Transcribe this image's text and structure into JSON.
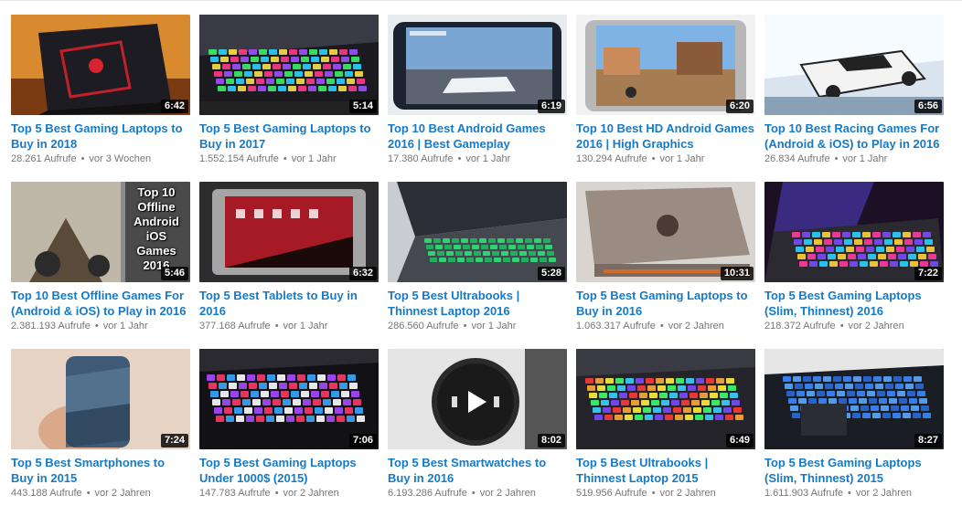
{
  "colors": {
    "title_link": "#167ac6",
    "meta_text": "#767676",
    "duration_bg": "#000000"
  },
  "videos": [
    {
      "title": "Top 5 Best Gaming Laptops to Buy in 2018",
      "views": "28.261 Aufrufe",
      "age": "vor 3 Wochen",
      "duration": "6:42",
      "thumb": "laptop-red"
    },
    {
      "title": "Top 5 Best Gaming Laptops to Buy in 2017",
      "views": "1.552.154 Aufrufe",
      "age": "vor 1 Jahr",
      "duration": "5:14",
      "thumb": "keyboard-rgb"
    },
    {
      "title": "Top 10 Best Android Games 2016 | Best Gameplay",
      "views": "17.380 Aufrufe",
      "age": "vor 1 Jahr",
      "duration": "6:19",
      "thumb": "phone-racing"
    },
    {
      "title": "Top 10 Best HD Android Games 2016 | High Graphics",
      "views": "130.294 Aufrufe",
      "age": "vor 1 Jahr",
      "duration": "6:20",
      "thumb": "phone-town"
    },
    {
      "title": "Top 10 Best Racing Games For (Android & iOS) to Play in 2016",
      "views": "26.834 Aufrufe",
      "age": "vor 1 Jahr",
      "duration": "6:56",
      "thumb": "snow-car"
    },
    {
      "title": "Top 10 Best Offline Games For (Android & iOS) to Play in 2016",
      "views": "2.381.193 Aufrufe",
      "age": "vor 1 Jahr",
      "duration": "5:46",
      "thumb": "offline-games",
      "overlay_text": [
        "Top 10",
        "Offline",
        "Android",
        "iOS",
        "Games",
        "2016"
      ]
    },
    {
      "title": "Top 5 Best Tablets to Buy in 2016",
      "views": "377.168 Aufrufe",
      "age": "vor 1 Jahr",
      "duration": "6:32",
      "thumb": "tablet"
    },
    {
      "title": "Top 5 Best Ultrabooks | Thinnest Laptop 2016",
      "views": "286.560 Aufrufe",
      "age": "vor 1 Jahr",
      "duration": "5:28",
      "thumb": "ultrabook-green"
    },
    {
      "title": "Top 5 Best Gaming Laptops to Buy in 2016",
      "views": "1.063.317 Aufrufe",
      "age": "vor 2 Jahren",
      "duration": "10:31",
      "thumb": "rog-laptop"
    },
    {
      "title": "Top 5 Best Gaming Laptops (Slim, Thinnest) 2016",
      "views": "218.372 Aufrufe",
      "age": "vor 2 Jahren",
      "duration": "7:22",
      "thumb": "laptop-purple"
    },
    {
      "title": "Top 5 Best Smartphones to Buy in 2015",
      "views": "443.188 Aufrufe",
      "age": "vor 2 Jahren",
      "duration": "7:24",
      "thumb": "phone-hand"
    },
    {
      "title": "Top 5 Best Gaming Laptops Under 1000$ (2015)",
      "views": "147.783 Aufrufe",
      "age": "vor 2 Jahren",
      "duration": "7:06",
      "thumb": "keyboard-dark"
    },
    {
      "title": "Top 5 Best Smartwatches to Buy in 2016",
      "views": "6.193.286 Aufrufe",
      "age": "vor 2 Jahren",
      "duration": "8:02",
      "thumb": "smartwatch"
    },
    {
      "title": "Top 5 Best Ultrabooks | Thinnest Laptop 2015",
      "views": "519.956 Aufrufe",
      "age": "vor 2 Jahren",
      "duration": "6:49",
      "thumb": "keyboard-rainbow"
    },
    {
      "title": "Top 5 Best Gaming Laptops (Slim, Thinnest) 2015",
      "views": "1.611.903 Aufrufe",
      "age": "vor 2 Jahren",
      "duration": "8:27",
      "thumb": "keyboard-blue"
    }
  ]
}
